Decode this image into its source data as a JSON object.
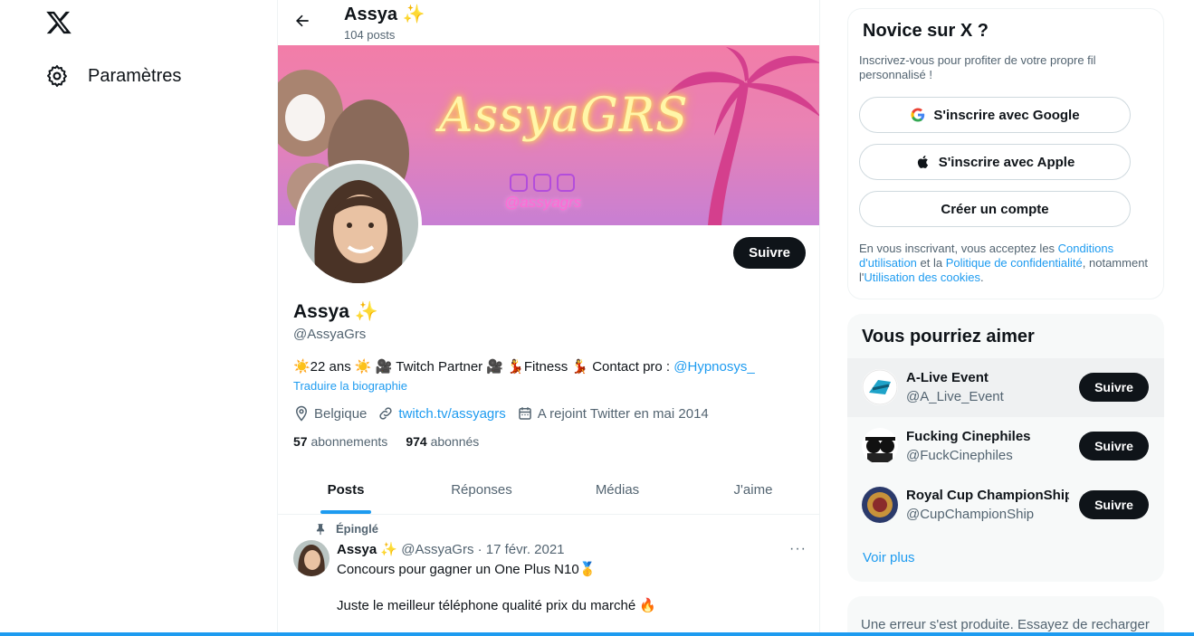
{
  "nav": {
    "settings_label": "Paramètres"
  },
  "header": {
    "name": "Assya ✨",
    "post_count": "104 posts"
  },
  "banner": {
    "title": "AssyaGRS",
    "handle": "@assyagrs"
  },
  "profile": {
    "follow_label": "Suivre",
    "name": "Assya ✨",
    "handle": "@AssyaGrs",
    "bio_text": "☀️22 ans ☀️ 🎥 Twitch Partner 🎥 💃Fitness 💃 Contact pro : ",
    "bio_link": "@Hypnosys_",
    "translate_label": "Traduire la biographie",
    "location": "Belgique",
    "website": "twitch.tv/assyagrs",
    "joined": "A rejoint Twitter en mai 2014",
    "following_count": "57",
    "following_label": "abonnements",
    "followers_count": "974",
    "followers_label": "abonnés"
  },
  "tabs": [
    {
      "label": "Posts",
      "active": true
    },
    {
      "label": "Réponses",
      "active": false
    },
    {
      "label": "Médias",
      "active": false
    },
    {
      "label": "J'aime",
      "active": false
    }
  ],
  "pinned_post": {
    "pinned_label": "Épinglé",
    "author": "Assya ✨",
    "handle_date": "@AssyaGrs · 17 févr. 2021",
    "line1": "Concours pour gagner un One Plus N10🥇",
    "line2": "Juste le meilleur téléphone qualité prix du marché 🔥",
    "more": "···"
  },
  "signup": {
    "title": "Novice sur X ?",
    "subtitle": "Inscrivez-vous pour profiter de votre propre fil personnalisé !",
    "google_label": "S'inscrire avec Google",
    "apple_label": "S'inscrire avec Apple",
    "create_label": "Créer un compte",
    "terms_1": "En vous inscrivant, vous acceptez les ",
    "terms_link_1": "Conditions d'utilisation",
    "terms_2": " et la ",
    "terms_link_2": "Politique de confidentialité",
    "terms_3": ", notamment l'",
    "terms_link_3": "Utilisation des cookies",
    "terms_4": "."
  },
  "suggestions": {
    "title": "Vous pourriez aimer",
    "items": [
      {
        "name": "A-Live Event",
        "handle": "@A_Live_Event",
        "button": "Suivre"
      },
      {
        "name": "Fucking Cinephiles",
        "handle": "@FuckCinephiles",
        "button": "Suivre"
      },
      {
        "name": "Royal Cup ChampionShip",
        "handle": "@CupChampionShip",
        "button": "Suivre"
      }
    ],
    "more_label": "Voir plus"
  },
  "error": {
    "text": "Une erreur s'est produite. Essayez de recharger"
  },
  "colors": {
    "accent": "#1d9bf0",
    "text": "#0f1419",
    "muted": "#536471",
    "button_dark": "#0f1419"
  }
}
